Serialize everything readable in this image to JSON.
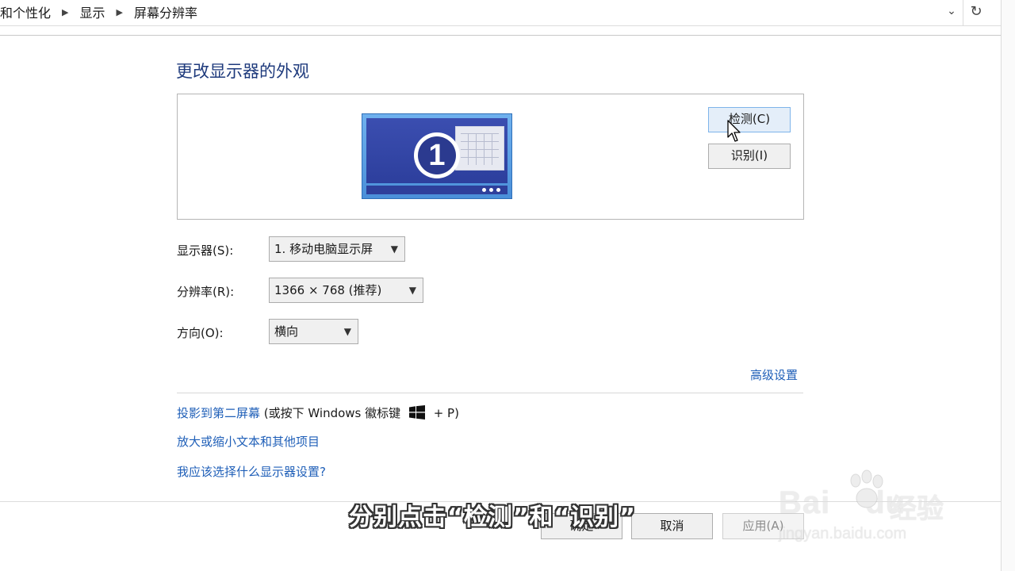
{
  "breadcrumb": {
    "items": [
      "和个性化",
      "显示",
      "屏幕分辨率"
    ]
  },
  "page": {
    "title": "更改显示器的外观"
  },
  "preview": {
    "monitor_number": "1",
    "detect_button": "检测(C)",
    "identify_button": "识别(I)"
  },
  "settings": {
    "display_label": "显示器(S):",
    "display_value": "1. 移动电脑显示屏",
    "resolution_label": "分辨率(R):",
    "resolution_value": "1366 × 768 (推荐)",
    "orientation_label": "方向(O):",
    "orientation_value": "横向"
  },
  "advanced_link": "高级设置",
  "links": {
    "project_link": "投影到第二屏幕",
    "project_hint_prefix": "(或按下 Windows 徽标键",
    "project_hint_suffix": "+ P)",
    "zoom_link": "放大或缩小文本和其他项目",
    "help_link": "我应该选择什么显示器设置?"
  },
  "footer": {
    "ok": "确定",
    "cancel": "取消",
    "apply": "应用(A)"
  },
  "overlay": {
    "subtitle": "分别点击“检测”和“识别”"
  },
  "watermark": {
    "brand": "Bai",
    "brand_suffix": "du",
    "cn": "经验",
    "url": "jingyan.baidu.com"
  },
  "colors": {
    "link": "#1f5fb8",
    "title": "#1e3a7c",
    "monitor_blue": "#2d3f9d"
  }
}
